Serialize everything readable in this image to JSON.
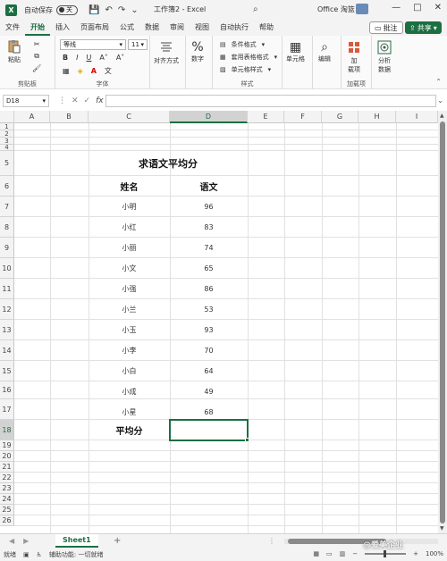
{
  "titlebar": {
    "autosave_label": "自动保存",
    "autosave_state": "关",
    "doc_title": "工作簿2 - Excel",
    "user_name": "Office 淘篮",
    "minimize": "—",
    "maximize": "□",
    "close": "✕"
  },
  "tabs": [
    "文件",
    "开始",
    "插入",
    "页面布局",
    "公式",
    "数据",
    "审阅",
    "视图",
    "自动执行",
    "帮助"
  ],
  "comment_label": "批注",
  "share_label": "共享",
  "ribbon": {
    "paste_label": "粘贴",
    "clipboard_group": "剪贴板",
    "font_name": "等线",
    "font_size": "11",
    "font_group": "字体",
    "bold": "B",
    "italic": "I",
    "underline": "U",
    "align_label": "对齐方式",
    "number_label": "数字",
    "cond_format": "条件格式",
    "table_format": "套用表格格式",
    "cell_style": "单元格样式",
    "styles_group": "样式",
    "cells_label": "单元格",
    "edit_label": "编辑",
    "addin_label_1": "加",
    "addin_label_2": "载项",
    "addin_group": "加载项",
    "analyze_label_1": "分析",
    "analyze_label_2": "数据"
  },
  "formula_bar": {
    "name_box": "D18",
    "fx": "fx",
    "value": ""
  },
  "columns": [
    "A",
    "B",
    "C",
    "D",
    "E",
    "F",
    "G",
    "H",
    "I"
  ],
  "sheet": {
    "title": "求语文平均分",
    "header_name": "姓名",
    "header_score": "语文",
    "rows": [
      {
        "name": "小明",
        "score": "96"
      },
      {
        "name": "小红",
        "score": "83"
      },
      {
        "name": "小丽",
        "score": "74"
      },
      {
        "name": "小文",
        "score": "65"
      },
      {
        "name": "小强",
        "score": "86"
      },
      {
        "name": "小兰",
        "score": "53"
      },
      {
        "name": "小玉",
        "score": "93"
      },
      {
        "name": "小李",
        "score": "70"
      },
      {
        "name": "小白",
        "score": "64"
      },
      {
        "name": "小成",
        "score": "49"
      },
      {
        "name": "小星",
        "score": "68"
      }
    ],
    "avg_label": "平均分",
    "avg_value": ""
  },
  "sheet_tabs": {
    "active": "Sheet1",
    "add": "+"
  },
  "statusbar": {
    "ready": "就绪",
    "accessibility": "辅助功能: 一切就绪",
    "zoom": "100%"
  },
  "watermark": "@爱美企业",
  "colors": {
    "accent": "#1d6f42"
  }
}
